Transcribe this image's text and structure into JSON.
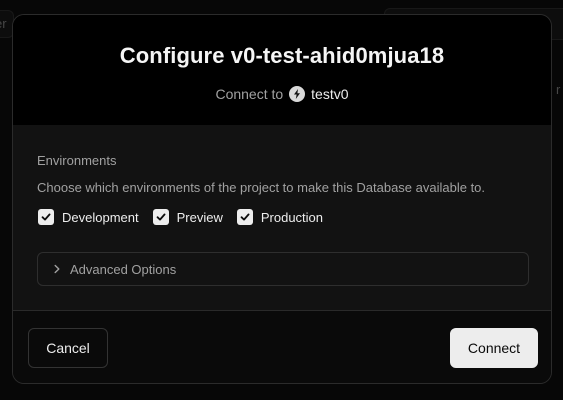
{
  "background": {
    "left_fragment_text": "er",
    "right_fragment_text": "r"
  },
  "dialog": {
    "title": "Configure v0-test-ahid0mjua18",
    "subtitle_prefix": "Connect to",
    "team_icon": "vercel-bolt-icon",
    "team_name": "testv0"
  },
  "environments": {
    "label": "Environments",
    "description": "Choose which environments of the project to make this Database available to.",
    "options": [
      {
        "label": "Development",
        "checked": true
      },
      {
        "label": "Preview",
        "checked": true
      },
      {
        "label": "Production",
        "checked": true
      }
    ]
  },
  "advanced_options": {
    "label": "Advanced Options",
    "expanded": false,
    "icon": "chevron-right-icon"
  },
  "footer": {
    "cancel_label": "Cancel",
    "connect_label": "Connect"
  },
  "colors": {
    "dialog_background": "#0a0a0a",
    "header_background": "#000000",
    "primary_button": "#ededed",
    "muted_text": "#a1a1a1"
  }
}
